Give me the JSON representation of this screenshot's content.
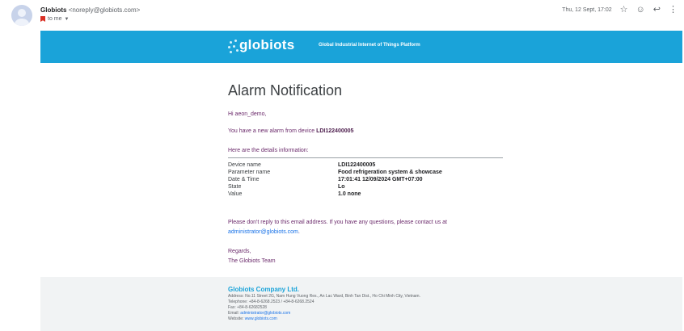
{
  "header": {
    "sender_name": "Globiots",
    "sender_email": "<noreply@globiots.com>",
    "to": "to me",
    "date": "Thu, 12 Sept, 17:02",
    "icons": [
      "star-icon",
      "emoji-icon",
      "reply-icon",
      "more-icon"
    ]
  },
  "banner": {
    "logo": "globiots",
    "tagline": "Global Industrial Internet of Things Platform",
    "color": "#1aa3d9"
  },
  "email": {
    "title": "Alarm Notification",
    "greeting": "Hi aeon_demo,",
    "alarm_intro": "You have a new alarm from device",
    "device_id": "LDI122400005",
    "details_intro": "Here are the details information:",
    "details": [
      {
        "label": "Device name",
        "value": "LDI122400005"
      },
      {
        "label": "Parameter name",
        "value": "Food refrigeration system & showcase"
      },
      {
        "label": "Date & Time",
        "value": "17:01:41 12/09/2024 GMT+07:00"
      },
      {
        "label": "State",
        "value": "Lo"
      },
      {
        "label": "Value",
        "value": "1.0 none"
      }
    ],
    "contact_text": "Please don't reply to this email address. If you have any questions, please contact us at",
    "contact_email": "administrator@globiots.com",
    "contact_end": ".",
    "regards": "Regards,",
    "team": "The Globiots Team"
  },
  "footer": {
    "company": "Globiots Company Ltd.",
    "address": "Address: No.11 Street 2G, Nam Hung Vuong Res., An Lac Ward, Binh Tan Dist., Ho Chi Minh City, Vietnam.",
    "telephone": "Telephone: +84-8-6268.2523 / +84-8-6268.2524",
    "fax": "Fax: +84-8-62682528",
    "email_label": "Email:",
    "email": "administrator@globiots.com",
    "website_label": "Website:",
    "website": "www.globiots.com"
  }
}
